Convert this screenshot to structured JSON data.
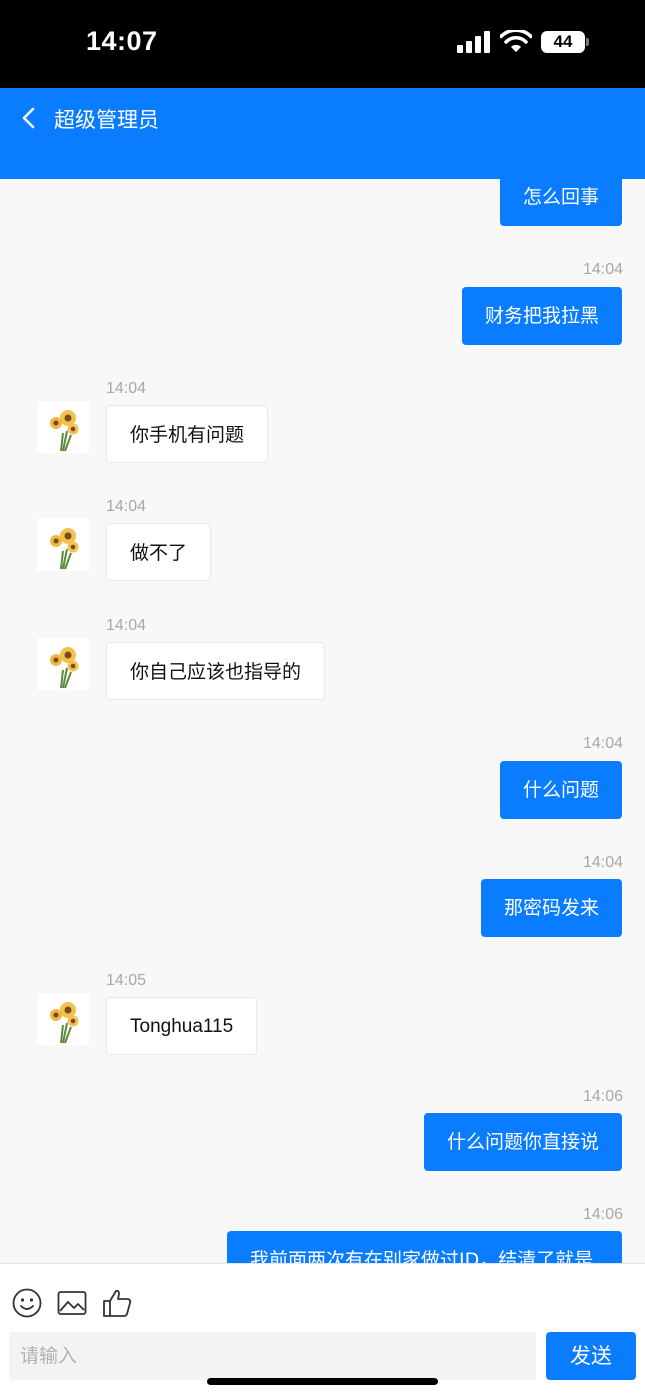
{
  "status": {
    "time": "14:07",
    "battery": "44"
  },
  "header": {
    "title": "超级管理员"
  },
  "messages": [
    {
      "side": "me",
      "text": "怎么回事"
    },
    {
      "side": "me",
      "time": "14:04",
      "text": "财务把我拉黑"
    },
    {
      "side": "them",
      "time": "14:04",
      "text": "你手机有问题"
    },
    {
      "side": "them",
      "time": "14:04",
      "text": "做不了"
    },
    {
      "side": "them",
      "time": "14:04",
      "text": "你自己应该也指导的"
    },
    {
      "side": "me",
      "time": "14:04",
      "text": "什么问题"
    },
    {
      "side": "me",
      "time": "14:04",
      "text": "那密码发来"
    },
    {
      "side": "them",
      "time": "14:05",
      "text": "Tonghua115"
    },
    {
      "side": "me",
      "time": "14:06",
      "text": "什么问题你直接说"
    },
    {
      "side": "me",
      "time": "14:06",
      "text": "我前面两次有在别家做过ID，结清了就是"
    }
  ],
  "composer": {
    "placeholder": "请输入",
    "send_label": "发送"
  },
  "icons": {
    "emoji": "smiley-icon",
    "image": "image-icon",
    "like": "thumbs-up-icon"
  },
  "colors": {
    "accent": "#0a7cff",
    "background": "#f8f8f8"
  }
}
